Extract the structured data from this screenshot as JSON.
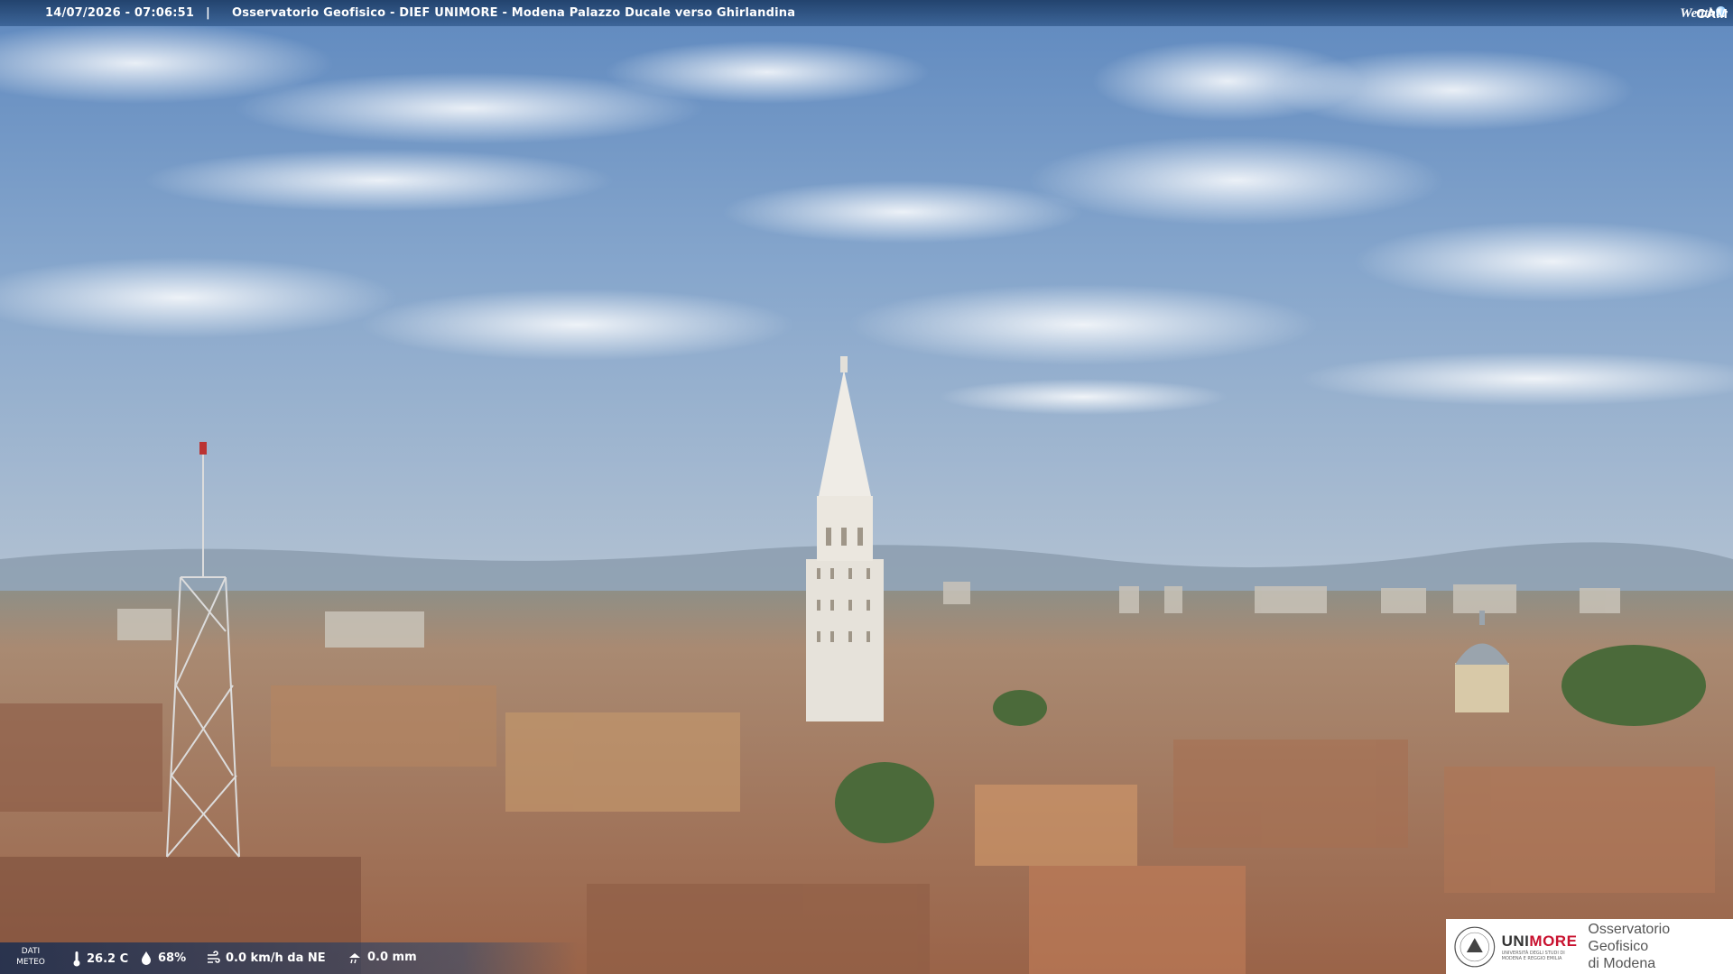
{
  "overlay": {
    "timestamp": "14/07/2026 - 07:06:51",
    "separator": "|",
    "title": "Osservatorio Geofisico - DIEF UNIMORE - Modena Palazzo Ducale verso Ghirlandina",
    "logo_weather": "Weather",
    "logo_cam": "CAM"
  },
  "weather": {
    "label_line1": "DATI",
    "label_line2": "METEO",
    "temperature": "26.2 C",
    "humidity": "68%",
    "wind": "0.0 km/h da NE",
    "rain": "0.0 mm",
    "icons": [
      "thermometer-icon",
      "humidity-drop-icon",
      "wind-icon",
      "rain-icon"
    ]
  },
  "branding": {
    "university": "UNIMORE",
    "university_sub": "UNIVERSITÀ DEGLI STUDI DI MODENA E REGGIO EMILIA",
    "observatory_line1": "Osservatorio Geofisico",
    "observatory_line2": "di Modena",
    "brand_color": "#c8102e"
  },
  "colors": {
    "sky_top": "#6f95c4",
    "sky_bottom": "#a9bcd0",
    "roofs": "#b07a58",
    "tower": "#e9e6df"
  }
}
